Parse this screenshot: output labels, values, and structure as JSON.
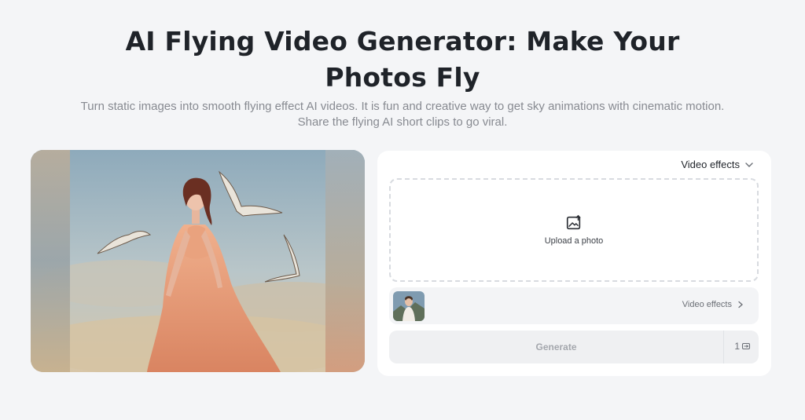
{
  "header": {
    "title": "AI Flying Video Generator: Make Your Photos Fly",
    "subtitle": "Turn static images into smooth flying effect AI videos. It is fun and creative way to get sky animations with cinematic motion. Share the flying AI short clips to go viral."
  },
  "panel": {
    "effects_select_label": "Video effects",
    "upload_label": "Upload a photo",
    "effect_row_label": "Video effects",
    "generate_label": "Generate",
    "credit_cost": "1"
  },
  "colors": {
    "background": "#f4f5f7",
    "panel": "#ffffff",
    "dress": "#e49a76"
  },
  "icons": {
    "select_chevron": "chevron-down-icon",
    "upload": "image-upload-icon",
    "row_chevron": "chevron-right-icon",
    "credit": "credit-coin-icon"
  }
}
